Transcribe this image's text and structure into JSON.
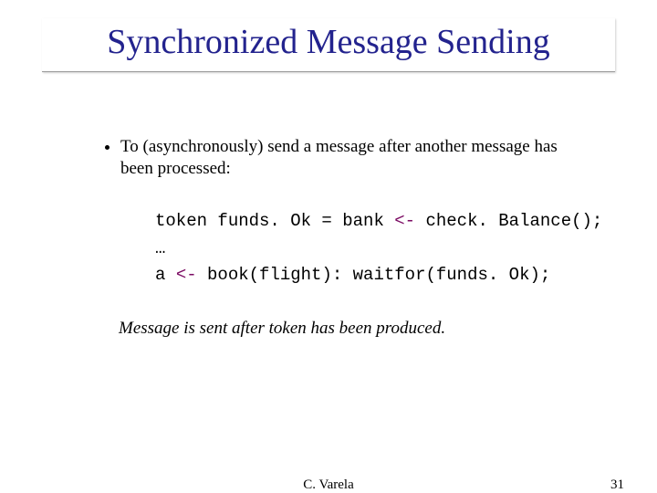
{
  "title": "Synchronized Message Sending",
  "bullet": "To (asynchronously) send a message after another message has been processed:",
  "code": {
    "l1a": "token funds. Ok = bank ",
    "arrow": "<-",
    "l1b": " check. Balance(); ",
    "l2": "…",
    "l3a": "a ",
    "l3b": " book(flight): waitfor(funds. Ok); "
  },
  "note": "Message is sent after token has been produced.",
  "footer": {
    "author": "C. Varela",
    "page": "31"
  }
}
